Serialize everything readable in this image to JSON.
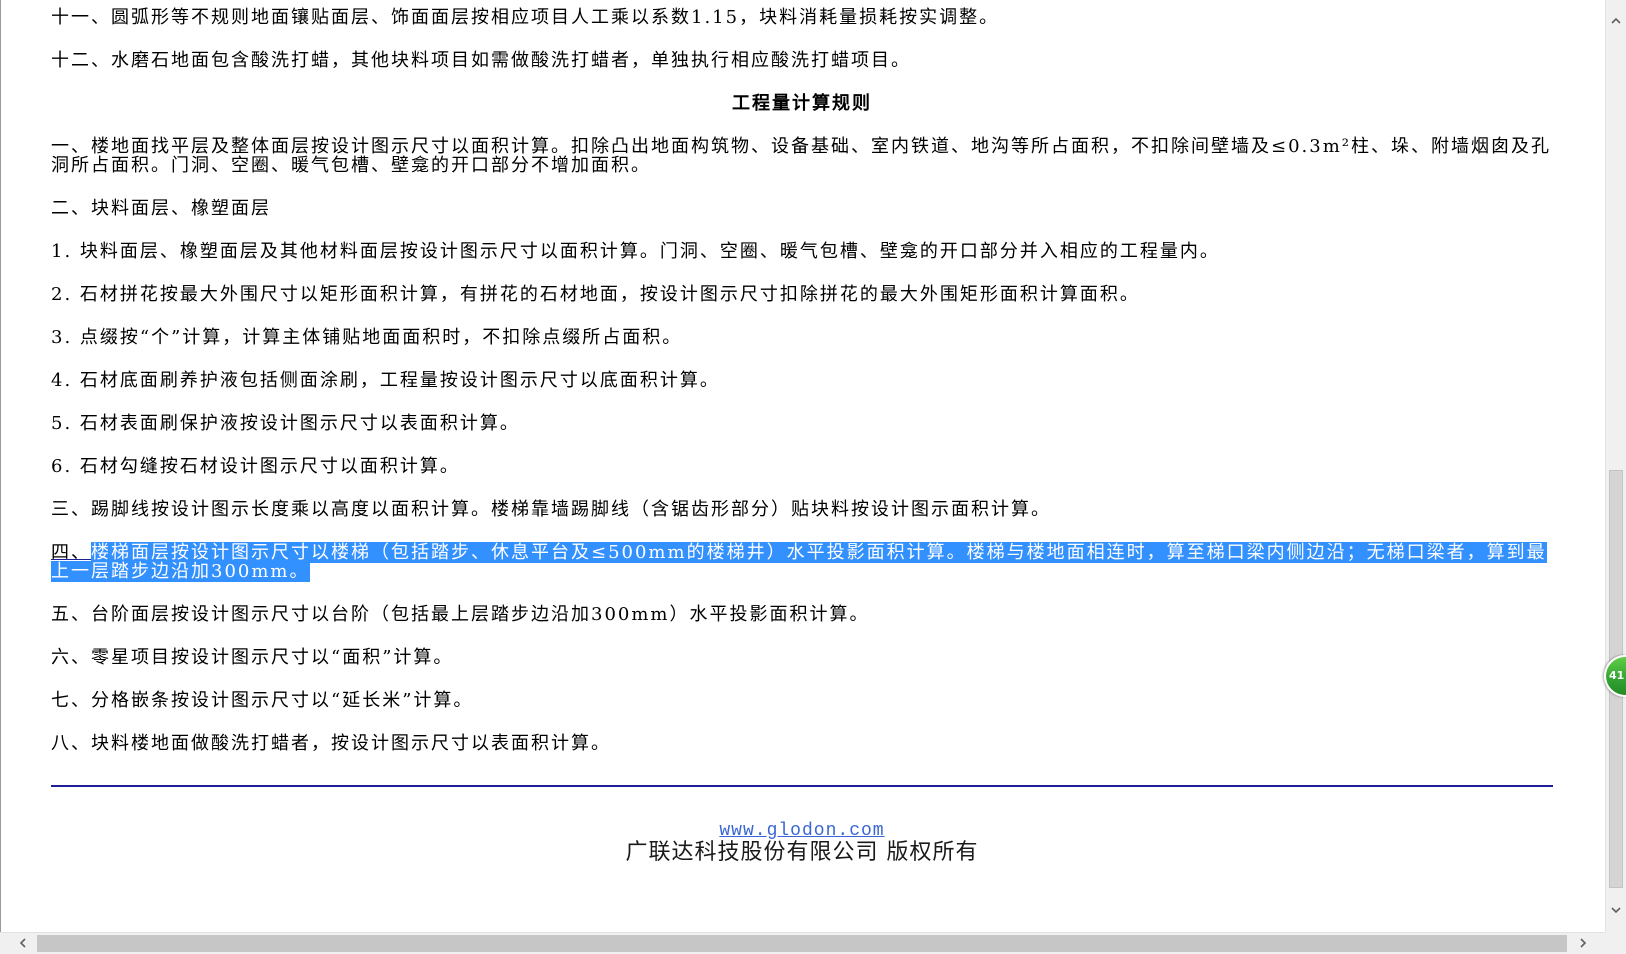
{
  "content": {
    "intro": [
      "十一、圆弧形等不规则地面镶贴面层、饰面面层按相应项目人工乘以系数1.15，块料消耗量损耗按实调整。",
      "十二、水磨石地面包含酸洗打蜡，其他块料项目如需做酸洗打蜡者，单独执行相应酸洗打蜡项目。"
    ],
    "section_title": "工程量计算规则",
    "rules": [
      "一、楼地面找平层及整体面层按设计图示尺寸以面积计算。扣除凸出地面构筑物、设备基础、室内铁道、地沟等所占面积，不扣除间壁墙及≤0.3m²柱、垛、附墙烟囱及孔洞所占面积。门洞、空圈、暖气包槽、壁龛的开口部分不增加面积。",
      "二、块料面层、橡塑面层",
      "1. 块料面层、橡塑面层及其他材料面层按设计图示尺寸以面积计算。门洞、空圈、暖气包槽、壁龛的开口部分并入相应的工程量内。",
      "2. 石材拼花按最大外围尺寸以矩形面积计算，有拼花的石材地面，按设计图示尺寸扣除拼花的最大外围矩形面积计算面积。",
      "3. 点缀按“个”计算，计算主体铺贴地面面积时，不扣除点缀所占面积。",
      "4. 石材底面刷养护液包括侧面涂刷，工程量按设计图示尺寸以底面积计算。",
      "5. 石材表面刷保护液按设计图示尺寸以表面积计算。",
      "6. 石材勾缝按石材设计图示尺寸以面积计算。",
      "三、踢脚线按设计图示长度乘以高度以面积计算。楼梯靠墙踢脚线（含锯齿形部分）贴块料按设计图示面积计算。"
    ],
    "selected_rule": {
      "prefix": "四、",
      "selected_text": "楼梯面层按设计图示尺寸以楼梯（包括踏步、休息平台及≤500mm的楼梯井）水平投影面积计算。楼梯与楼地面相连时，算至梯口梁内侧边沿；无梯口梁者，算到最上一层踏步边沿加300mm。"
    },
    "rules_after": [
      "五、台阶面层按设计图示尺寸以台阶（包括最上层踏步边沿加300mm）水平投影面积计算。",
      "六、零星项目按设计图示尺寸以“面积”计算。",
      "七、分格嵌条按设计图示尺寸以“延长米”计算。",
      "八、块料楼地面做酸洗打蜡者，按设计图示尺寸以表面积计算。"
    ]
  },
  "footer": {
    "link_text": "www.glodon.com",
    "copyright": "广联达科技股份有限公司 版权所有"
  },
  "floating_badge": {
    "value": "41"
  },
  "scrollbars": {
    "vertical_percent": 100,
    "horizontal_percent": 0
  },
  "icons": {
    "scroll_up": "chevron-up-icon",
    "scroll_down": "chevron-down-icon",
    "scroll_left": "chevron-left-icon",
    "scroll_right": "chevron-right-icon"
  },
  "colors": {
    "selection": "#3390ff",
    "rule_line": "#1e1e96",
    "link": "#3a66d4",
    "badge": "#35a535",
    "scroll_track": "#f0f0f0",
    "scroll_thumb": "#c6c6c6"
  }
}
